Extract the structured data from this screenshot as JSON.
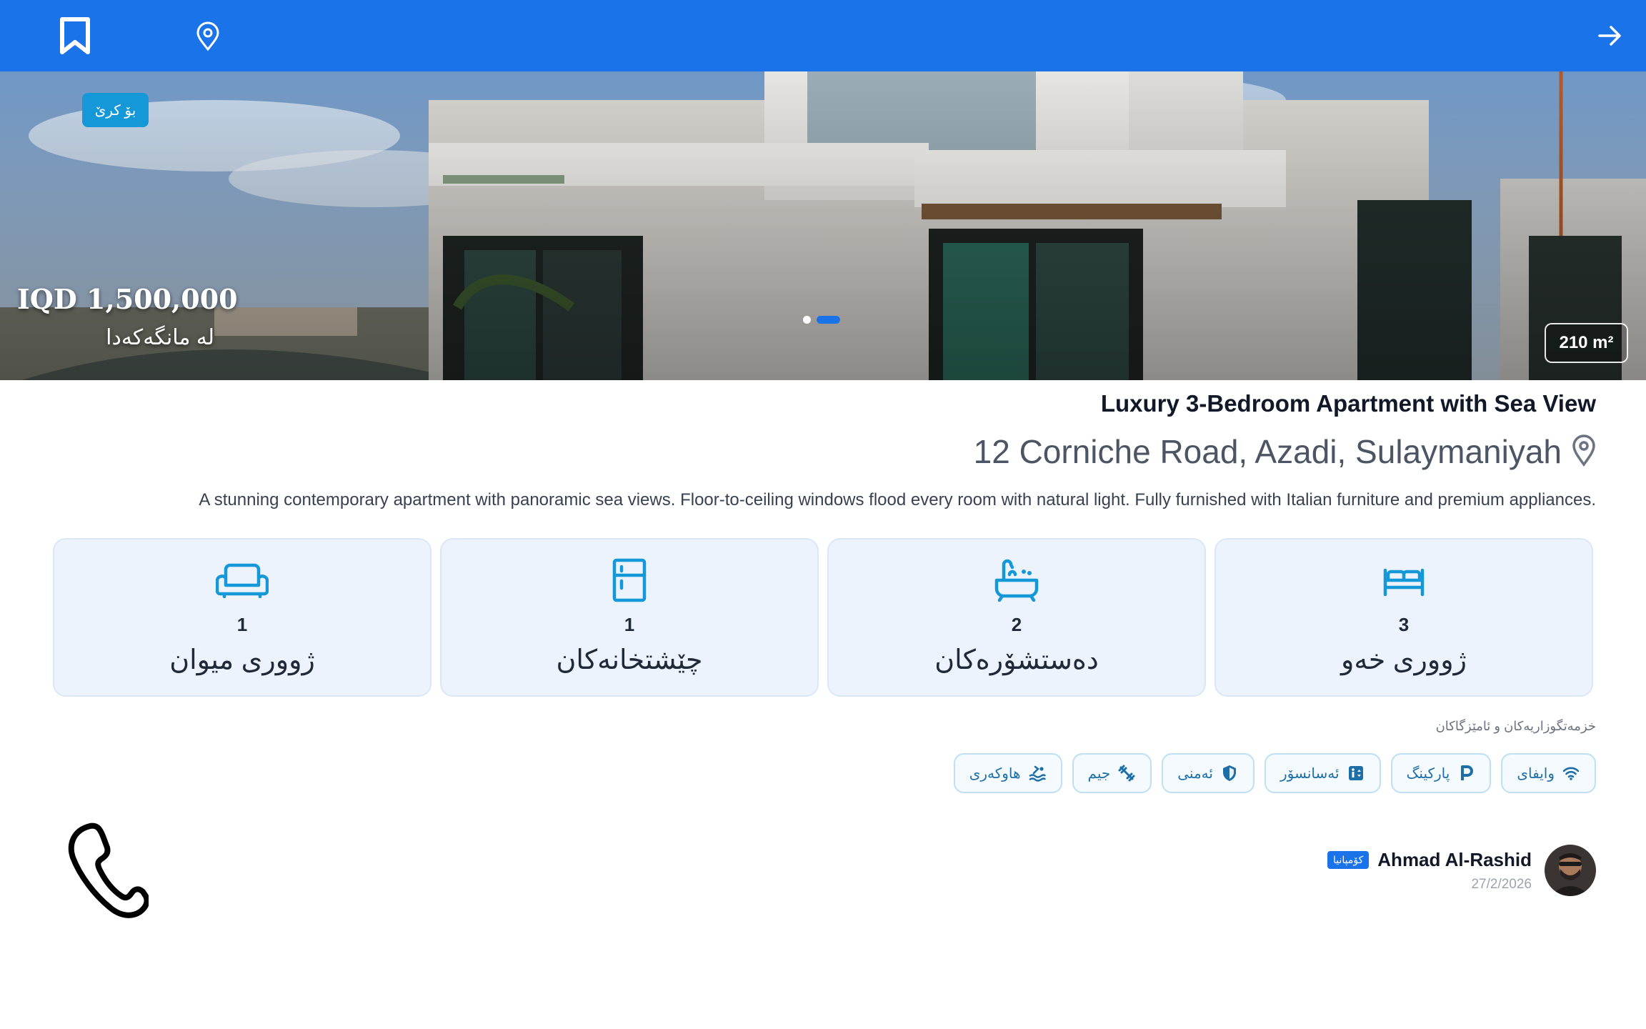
{
  "header": {
    "bookmark_icon": "bookmark-icon",
    "location_icon": "location-pin-icon",
    "back_icon": "arrow-right-icon",
    "bar_color": "#1a73e8"
  },
  "hero": {
    "badge": "بۆ کرێ",
    "price": "IQD 1,500,000",
    "period": "لە مانگەکەدا",
    "area": "210 m²",
    "slides_total": 2,
    "slide_active": 2
  },
  "listing": {
    "title": "Luxury 3-Bedroom Apartment with Sea View",
    "address": "12 Corniche Road, Azadi, Sulaymaniyah",
    "description": "A stunning contemporary apartment with panoramic sea views. Floor-to-ceiling windows flood every room with natural light. Fully furnished with Italian furniture and premium appliances."
  },
  "stats": [
    {
      "icon": "bed-icon",
      "value": "3",
      "label": "ژووری خەو"
    },
    {
      "icon": "bathtub-icon",
      "value": "2",
      "label": "دەستشۆرەکان"
    },
    {
      "icon": "kitchen-icon",
      "value": "1",
      "label": "چێشتخانەکان"
    },
    {
      "icon": "sofa-icon",
      "value": "1",
      "label": "ژووری میوان"
    }
  ],
  "amenities": {
    "heading": "خزمەتگوزاریەکان و ئامێزگاکان",
    "items": [
      {
        "icon": "wifi-icon",
        "label": "وایفای"
      },
      {
        "icon": "parking-icon",
        "label": "پارکینگ"
      },
      {
        "icon": "elevator-icon",
        "label": "ئەسانسۆر"
      },
      {
        "icon": "shield-icon",
        "label": "ئەمنی"
      },
      {
        "icon": "gym-icon",
        "label": "جیم"
      },
      {
        "icon": "pool-icon",
        "label": "هاوکەری"
      }
    ]
  },
  "owner": {
    "name": "Ahmad Al-Rashid",
    "badge": "کۆمپانیا",
    "date": "27/2/2026"
  },
  "contact": {
    "phone_icon": "phone-icon"
  },
  "colors": {
    "primary": "#1a73e8",
    "accent": "#1598d8",
    "card_bg": "#edf3fd"
  }
}
